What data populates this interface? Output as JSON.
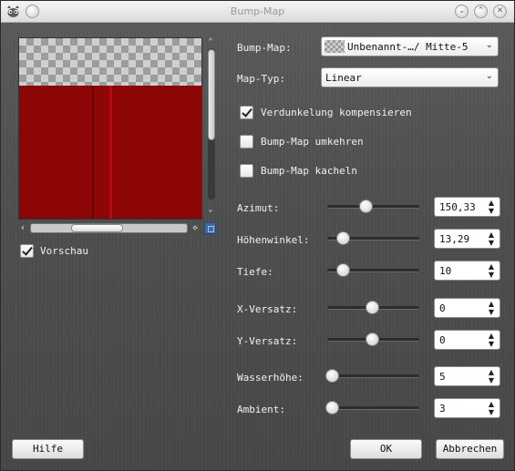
{
  "window": {
    "title": "Bump-Map"
  },
  "preview": {
    "show_preview_label": "Vorschau",
    "show_preview_checked": true,
    "hscroll_position": 0.33,
    "vscroll_position": 0.0
  },
  "settings": {
    "bump_map": {
      "label": "Bump-Map:",
      "value": "Unbenannt-…/ Mitte-5"
    },
    "map_type": {
      "label": "Map-Typ:",
      "value": "Linear"
    },
    "compensate_darkening": {
      "label": "Verdunkelung kompensieren",
      "checked": true
    },
    "invert_bumpmap": {
      "label": "Bump-Map umkehren",
      "checked": false
    },
    "tile_bumpmap": {
      "label": "Bump-Map kacheln",
      "checked": false
    }
  },
  "params": [
    {
      "key": "azimuth",
      "label": "Azimut:",
      "value": "150,33",
      "fraction": 0.42
    },
    {
      "key": "elevation",
      "label": "Höhenwinkel:",
      "value": "13,29",
      "fraction": 0.17
    },
    {
      "key": "depth",
      "label": "Tiefe:",
      "value": "10",
      "fraction": 0.17
    },
    {
      "key": "x_offset",
      "label": "X-Versatz:",
      "value": "0",
      "fraction": 0.49
    },
    {
      "key": "y_offset",
      "label": "Y-Versatz:",
      "value": "0",
      "fraction": 0.49
    },
    {
      "key": "waterlevel",
      "label": "Wasserhöhe:",
      "value": "5",
      "fraction": 0.05
    },
    {
      "key": "ambient",
      "label": "Ambient:",
      "value": "3",
      "fraction": 0.05
    }
  ],
  "buttons": {
    "help": "Hilfe",
    "ok": "OK",
    "cancel": "Abbrechen"
  },
  "colors": {
    "preview_red": "#8d0606",
    "nav_blue": "#3f6aa8"
  },
  "icons": [
    "gimp-icon",
    "minimize-icon",
    "maximize-icon",
    "close-icon",
    "chevron-down-icon",
    "spin-arrows-icon"
  ]
}
